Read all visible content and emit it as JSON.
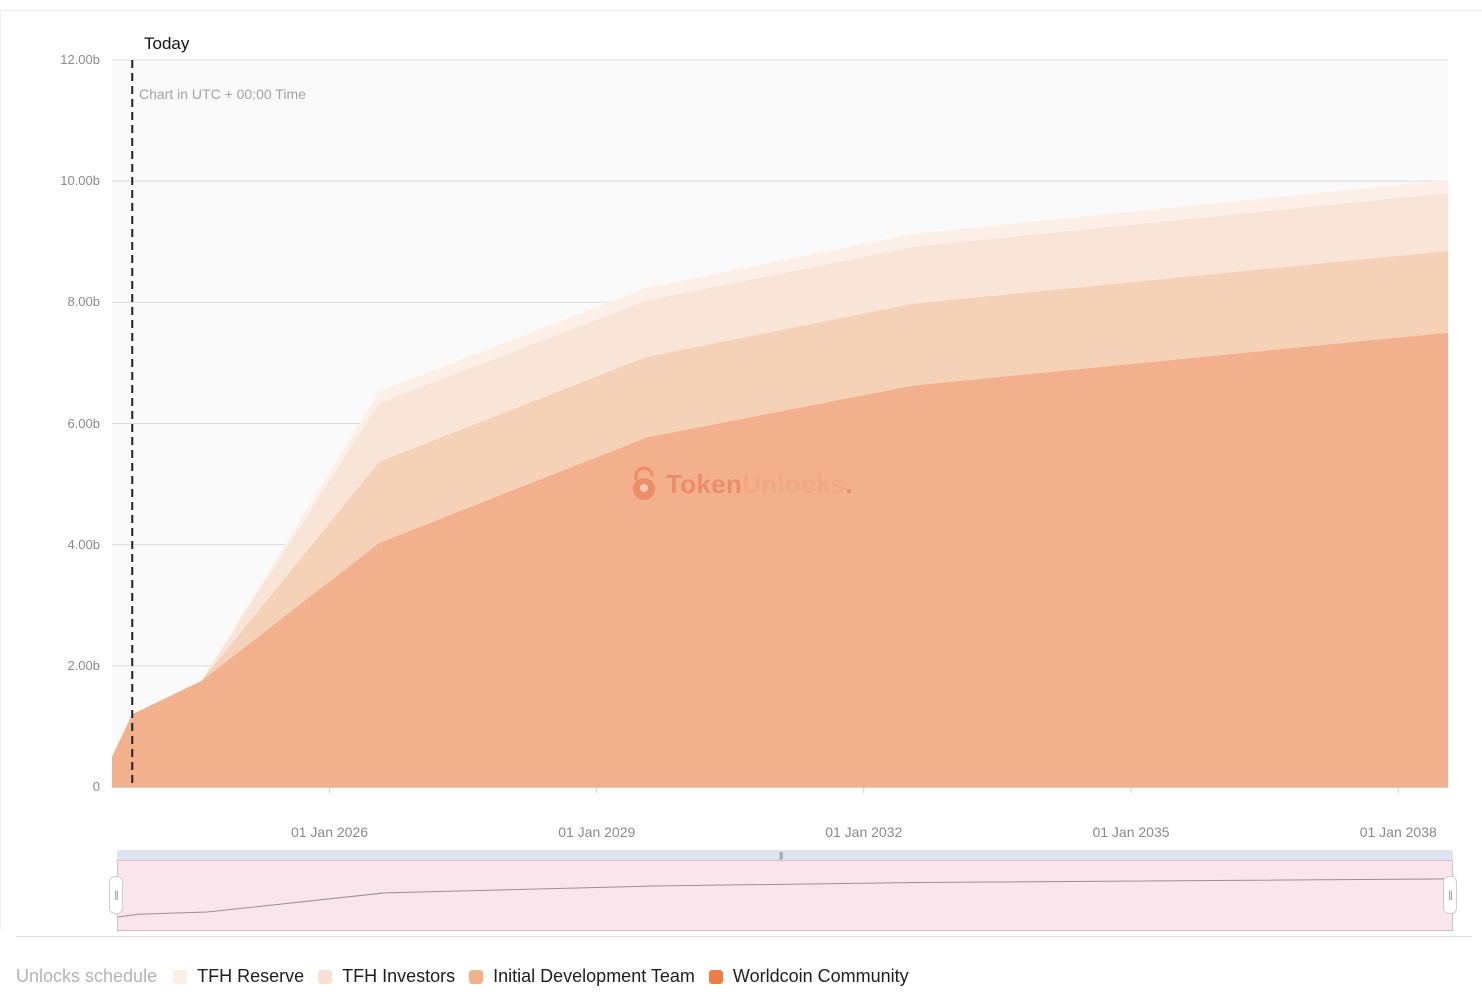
{
  "chart_data": {
    "type": "area",
    "stacked": true,
    "title": "",
    "xlabel": "",
    "ylabel": "",
    "note": "Chart in UTC + 00:00 Time",
    "marker": {
      "label": "Today",
      "date": "2023-10-15"
    },
    "ylim": [
      0,
      12
    ],
    "y_ticks": [
      "0",
      "2.00b",
      "4.00b",
      "6.00b",
      "8.00b",
      "10.00b",
      "12.00b"
    ],
    "x_ticks": [
      "01 Jan 2026",
      "01 Jan 2029",
      "01 Jan 2032",
      "01 Jan 2035",
      "01 Jan 2038"
    ],
    "x": [
      "2023-07-24",
      "2023-10-15",
      "2024-07-24",
      "2026-07-24",
      "2029-07-24",
      "2032-07-24",
      "2038-07-24"
    ],
    "series": [
      {
        "name": "Worldcoin Community",
        "color": "#f2b18c",
        "values": [
          0.5,
          1.2,
          1.75,
          4.03,
          5.77,
          6.63,
          7.5
        ]
      },
      {
        "name": "Initial Development Team",
        "color": "#f5d1b8",
        "values": [
          0.0,
          0.0,
          0.0,
          1.34,
          1.33,
          1.35,
          1.35
        ]
      },
      {
        "name": "TFH Investors",
        "color": "#f9e5d7",
        "values": [
          0.0,
          0.0,
          0.0,
          0.97,
          0.93,
          0.94,
          0.96
        ]
      },
      {
        "name": "TFH Reserve",
        "color": "#fcefe7",
        "values": [
          0.0,
          0.0,
          0.0,
          0.19,
          0.21,
          0.21,
          0.21
        ]
      }
    ],
    "watermark": "TokenUnlocks.",
    "legend_position": "bottom-left",
    "grid": true
  },
  "legend": {
    "title": "Unlocks schedule",
    "items": [
      {
        "label": "TFH Reserve",
        "color": "#fcefe7"
      },
      {
        "label": "TFH Investors",
        "color": "#f9e0d2"
      },
      {
        "label": "Initial Development Team",
        "color": "#f2b18c"
      },
      {
        "label": "Worldcoin Community",
        "color": "#ee7f44"
      }
    ]
  },
  "navigator": {
    "grip_symbol": "|||",
    "handle_symbol": "||"
  }
}
